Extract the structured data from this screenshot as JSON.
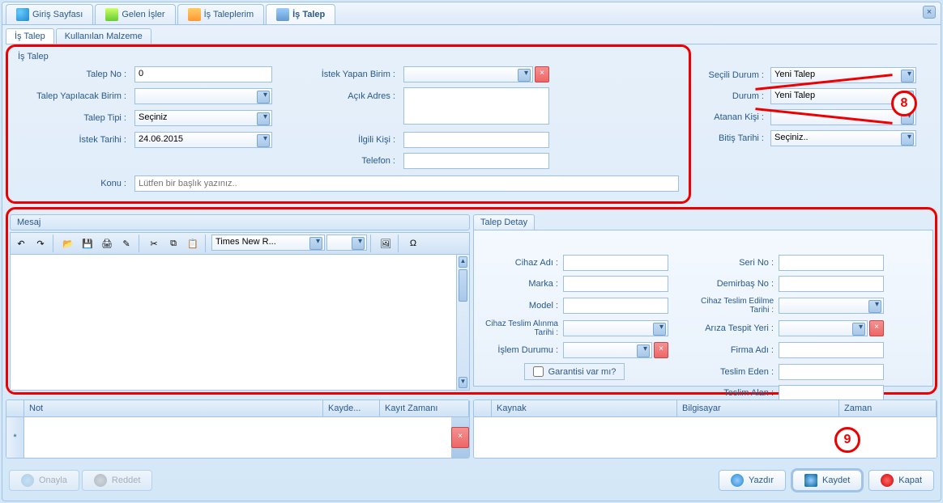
{
  "mainTabs": [
    {
      "label": "Giriş Sayfası",
      "icon": "home"
    },
    {
      "label": "Gelen İşler",
      "icon": "in"
    },
    {
      "label": "İş Taleplerim",
      "icon": "req"
    },
    {
      "label": "İş Talep",
      "icon": "job",
      "active": true
    }
  ],
  "subTabs": {
    "a": "İş Talep",
    "b": "Kullanılan Malzeme"
  },
  "fieldset": {
    "title": "İş Talep"
  },
  "labels": {
    "talepNo": "Talep No :",
    "talepBirim": "Talep Yapılacak Birim :",
    "talepTipi": "Talep Tipi :",
    "istekTarihi": "İstek Tarihi :",
    "istekBirim": "İstek Yapan Birim :",
    "acikAdres": "Açık Adres :",
    "ilgiliKisi": "İlgili Kişi :",
    "telefon": "Telefon :",
    "konu": "Konu :",
    "seciliDurum": "Seçili Durum :",
    "durum": "Durum :",
    "atananKisi": "Atanan Kişi :",
    "bitisTarihi": "Bitiş Tarihi :"
  },
  "values": {
    "talepNo": "0",
    "talepTipi": "Seçiniz",
    "istekTarihi": "24.06.2015",
    "konuPlaceholder": "Lütfen bir başlık yazınız..",
    "seciliDurum": "Yeni Talep",
    "durum": "Yeni Talep",
    "bitisTarihi": "Seçiniz.."
  },
  "panels": {
    "mesaj": "Mesaj",
    "talepDetay": "Talep Detay"
  },
  "editor": {
    "font": "Times New R..."
  },
  "detail": {
    "cihazAdi": "Cihaz Adı :",
    "marka": "Marka :",
    "model": "Model :",
    "teslimAlinma": "Cihaz Teslim Alınma Tarihi :",
    "islemDurumu": "İşlem Durumu :",
    "seriNo": "Seri No :",
    "demirbasNo": "Demirbaş No :",
    "teslimEdilme": "Cihaz Teslim Edilme Tarihi :",
    "arizaYeri": "Arıza Tespit Yeri :",
    "firmaAdi": "Firma Adı :",
    "teslimEden": "Teslim Eden :",
    "teslimAlan": "Teslim Alan :",
    "garanti": "Garantisi var mı?"
  },
  "grid1": {
    "not": "Not",
    "kayde": "Kayde...",
    "kayitZamani": "Kayıt Zamanı"
  },
  "grid2": {
    "kaynak": "Kaynak",
    "bilgisayar": "Bilgisayar",
    "zaman": "Zaman"
  },
  "footer": {
    "onayla": "Onayla",
    "reddet": "Reddet",
    "yazdir": "Yazdır",
    "kaydet": "Kaydet",
    "kapat": "Kapat"
  },
  "callouts": {
    "c8": "8",
    "c9": "9"
  }
}
